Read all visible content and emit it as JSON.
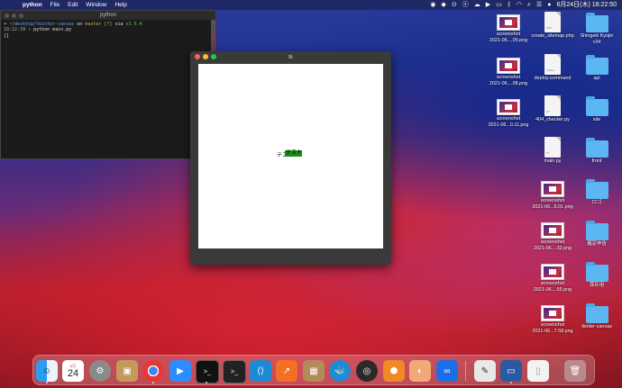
{
  "menubar": {
    "app_name": "python",
    "items": [
      "File",
      "Edit",
      "Window",
      "Help"
    ],
    "clock": "6月24日(木)  18:22:50"
  },
  "terminal": {
    "title": "python",
    "line1_path": "~/desktop/tkinter-canvas",
    "line1_on": " on ",
    "line1_branch": "master [?]",
    "line1_via": " via ",
    "line1_version": "v3.9.4",
    "line2_time": "18:22:39",
    "line2_cmd": " › python main.py",
    "line3": "[]"
  },
  "tk_window": {
    "title": "tk",
    "canvas_text_black": "テスト",
    "canvas_text_green": "テスト"
  },
  "desktop_icons": {
    "col1": [
      "screenshot\n2021-06....05.png",
      "screenshot\n2021-06....08.png",
      "screenshot\n2021-06...0.11.png"
    ],
    "col2_top": [
      "create_sitemap.php",
      "deploy.command",
      "404_checker.py",
      "main.py"
    ],
    "col3": [
      "Shingeki Kyojin\nv34",
      "api",
      "site",
      "front",
      "ロゴ",
      "確定申告",
      "保存用",
      "tkinter-canvas"
    ],
    "col2_bottom": [
      "screenshot\n2021-06...6.01.png",
      "screenshot\n2021-06....32.png",
      "screenshot\n2021-06....55.png",
      "screenshot\n2021-06...7.58.png"
    ]
  },
  "dock": {
    "calendar_month": "6月",
    "calendar_day": "24",
    "apps": [
      "Finder",
      "Calendar",
      "System Preferences",
      "Keka",
      "Chrome",
      "Zoom",
      "Terminal",
      "iTerm",
      "VS Code",
      "Monitor",
      "Archive",
      "Docker",
      "QuickTime",
      "Sourcetree",
      "Preview",
      "Infinity",
      "TextEdit",
      "Screenshot",
      "Document",
      "Trash"
    ]
  },
  "colors": {
    "folder": "#5cb6f2",
    "tk_green": "#1a8c1a",
    "terminal_bg": "#1b1b1b"
  }
}
